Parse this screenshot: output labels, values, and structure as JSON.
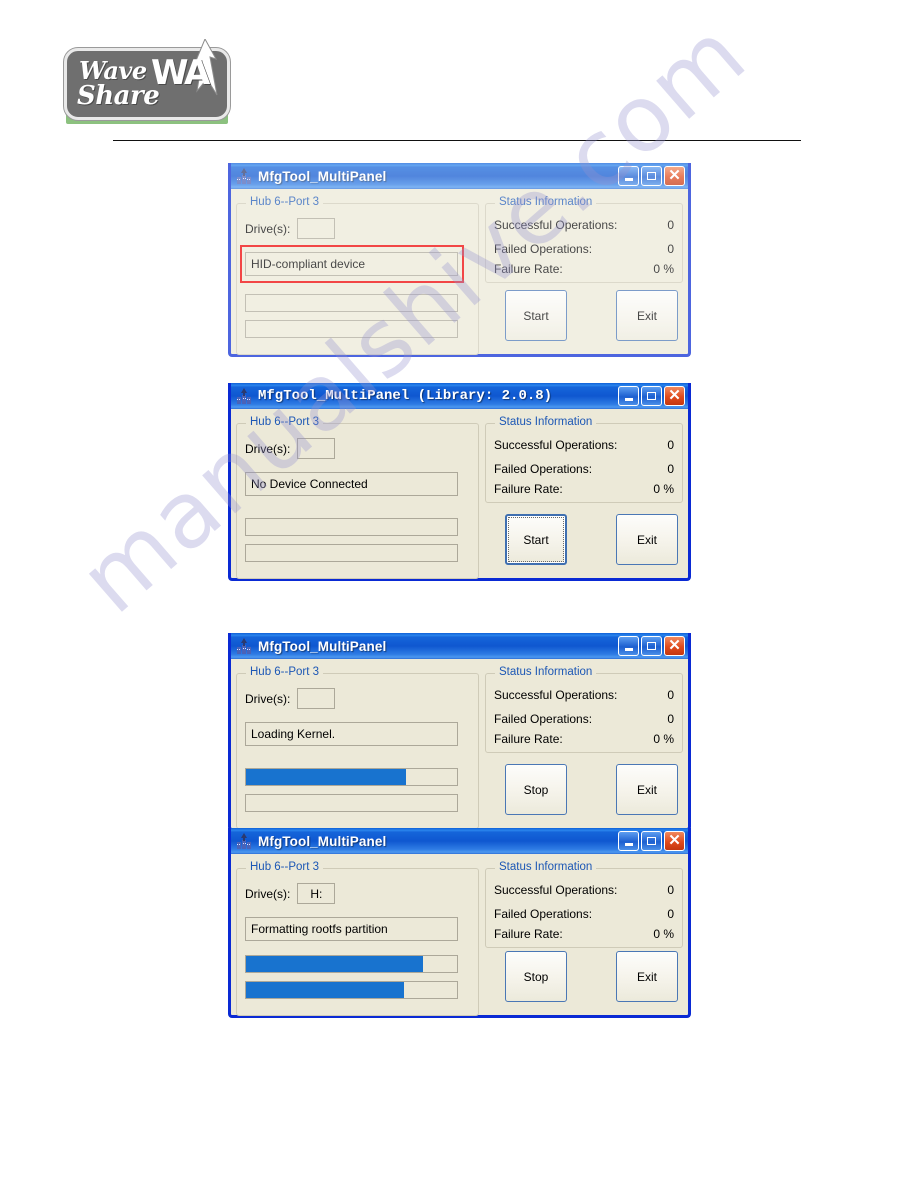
{
  "logo": {
    "line1": "Wave",
    "line2": "Share",
    "mark": "WA",
    "alt": "Waveshare logo"
  },
  "watermark": {
    "text": "manualshive.com"
  },
  "windows": [
    {
      "id": "win-hid-compliant",
      "title": "MfgTool_MultiPanel",
      "title_font": "sans",
      "faded": true,
      "group_left_title": "Hub 6--Port 3",
      "group_right_title": "Status Information",
      "drive_label": "Drive(s):",
      "drive_value": "",
      "status_text": "HID-compliant device",
      "highlight_status": true,
      "progress": [
        {
          "percent": 0
        },
        {
          "percent": 0
        }
      ],
      "stats": [
        {
          "label": "Successful Operations:",
          "value": "0"
        },
        {
          "label": "Failed Operations:",
          "value": "0"
        },
        {
          "label": "Failure Rate:",
          "value": "0 %"
        }
      ],
      "action_button": "Start",
      "action_focused": false,
      "exit_button": "Exit",
      "window_controls": {
        "minimize": "minimize",
        "maximize": "maximize",
        "close": "close"
      }
    },
    {
      "id": "win-no-device",
      "title": "MfgTool_MultiPanel (Library: 2.0.8)",
      "title_font": "mono",
      "faded": false,
      "group_left_title": "Hub 6--Port 3",
      "group_right_title": "Status Information",
      "drive_label": "Drive(s):",
      "drive_value": "",
      "status_text": "No Device Connected",
      "highlight_status": false,
      "progress": [
        {
          "percent": 0
        },
        {
          "percent": 0
        }
      ],
      "stats": [
        {
          "label": "Successful Operations:",
          "value": "0"
        },
        {
          "label": "Failed Operations:",
          "value": "0"
        },
        {
          "label": "Failure Rate:",
          "value": "0 %"
        }
      ],
      "action_button": "Start",
      "action_focused": true,
      "exit_button": "Exit",
      "window_controls": {
        "minimize": "minimize",
        "maximize": "maximize",
        "close": "close"
      }
    },
    {
      "id": "win-loading-kernel",
      "title": "MfgTool_MultiPanel",
      "title_font": "sans",
      "faded": false,
      "group_left_title": "Hub 6--Port 3",
      "group_right_title": "Status Information",
      "drive_label": "Drive(s):",
      "drive_value": "",
      "status_text": "Loading Kernel.",
      "highlight_status": false,
      "progress": [
        {
          "percent": 76
        },
        {
          "percent": 0
        }
      ],
      "stats": [
        {
          "label": "Successful Operations:",
          "value": "0"
        },
        {
          "label": "Failed Operations:",
          "value": "0"
        },
        {
          "label": "Failure Rate:",
          "value": "0 %"
        }
      ],
      "action_button": "Stop",
      "action_focused": false,
      "exit_button": "Exit",
      "window_controls": {
        "minimize": "minimize",
        "maximize": "maximize",
        "close": "close"
      }
    },
    {
      "id": "win-formatting-rootfs",
      "title": "MfgTool_MultiPanel",
      "title_font": "sans",
      "faded": false,
      "group_left_title": "Hub 6--Port 3",
      "group_right_title": "Status Information",
      "drive_label": "Drive(s):",
      "drive_value": "H:",
      "status_text": "Formatting rootfs partition",
      "highlight_status": false,
      "progress": [
        {
          "percent": 84
        },
        {
          "percent": 75
        }
      ],
      "stats": [
        {
          "label": "Successful Operations:",
          "value": "0"
        },
        {
          "label": "Failed Operations:",
          "value": "0"
        },
        {
          "label": "Failure Rate:",
          "value": "0 %"
        }
      ],
      "action_button": "Stop",
      "action_focused": false,
      "exit_button": "Exit",
      "window_controls": {
        "minimize": "minimize",
        "maximize": "maximize",
        "close": "close"
      }
    }
  ],
  "colors": {
    "titlebar_blue": "#0f57d0",
    "window_border": "#0a2ad4",
    "face": "#ece9d8",
    "group_label": "#1c57b5",
    "progress_fill": "#1873cf",
    "highlight_red": "#ee0000",
    "close_red": "#e04a1c"
  }
}
